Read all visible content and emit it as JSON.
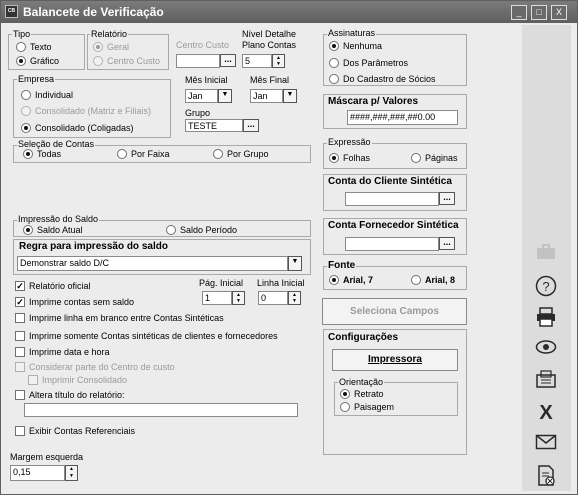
{
  "window": {
    "title": "Balancete de Verificação",
    "icon_text": "CB",
    "minimize": "_",
    "maximize": "□",
    "close": "X"
  },
  "tipo": {
    "label": "Tipo",
    "options": [
      "Texto",
      "Gráfico"
    ],
    "selected": "Gráfico"
  },
  "relatorio": {
    "label": "Relatório",
    "options": [
      "Geral",
      "Centro Custo"
    ],
    "selected": "Geral"
  },
  "centro_custo": {
    "label": "Centro Custo",
    "value": "",
    "button": "..."
  },
  "nivel_detalhe": {
    "label_1": "Nível Detalhe",
    "label_2": "Plano Contas",
    "value": "5"
  },
  "empresa": {
    "label": "Empresa",
    "options": [
      "Individual",
      "Consolidado (Matriz e Filiais)",
      "Consolidado (Coligadas)"
    ],
    "selected": "Consolidado (Coligadas)"
  },
  "mes_inicial": {
    "label": "Mês Inicial",
    "value": "Jan"
  },
  "mes_final": {
    "label": "Mês Final",
    "value": "Jan"
  },
  "grupo": {
    "label": "Grupo",
    "value": "TESTE",
    "button": "..."
  },
  "selecao_contas": {
    "label": "Seleção de Contas",
    "options": [
      "Todas",
      "Por Faixa",
      "Por Grupo"
    ],
    "selected": "Todas"
  },
  "impressao_saldo": {
    "label": "Impressão do Saldo",
    "options": [
      "Saldo Atual",
      "Saldo Período"
    ],
    "selected": "Saldo Atual"
  },
  "regra_impressao": {
    "label": "Regra para impressão do saldo",
    "value": "Demonstrar saldo D/C"
  },
  "relatorio_oficial": {
    "label": "Relatório oficial",
    "checked": true
  },
  "pag_inicial": {
    "label": "Pág. Inicial",
    "value": "1"
  },
  "linha_inicial": {
    "label": "Linha Inicial",
    "value": "0"
  },
  "checks": [
    {
      "label": "Imprime contas sem saldo",
      "checked": true
    },
    {
      "label": "Imprime linha em branco entre Contas Sintéticas",
      "checked": false
    },
    {
      "label": "Imprime somente Contas sintéticas  de clientes e fornecedores",
      "checked": false
    },
    {
      "label": "Imprime data e hora",
      "checked": false
    },
    {
      "label": "Considerar parte do Centro de custo",
      "checked": false
    },
    {
      "label": "Imprimir Consolidado",
      "checked": false
    },
    {
      "label": "Altera título do relatório:",
      "checked": false
    },
    {
      "label": "Exibir Contas Referenciais",
      "checked": false
    }
  ],
  "titulo_relatorio": {
    "value": ""
  },
  "margem_esquerda": {
    "label": "Margem esquerda",
    "value": "0,15"
  },
  "assinaturas": {
    "label": "Assinaturas",
    "options": [
      "Nenhuma",
      "Dos Parâmetros",
      "Do Cadastro de Sócios"
    ],
    "selected": "Nenhuma"
  },
  "mascara": {
    "label": "Máscara p/ Valores",
    "value": "####,###,###,##0.00"
  },
  "expressao": {
    "label": "Expressão",
    "options": [
      "Folhas",
      "Páginas"
    ],
    "selected": "Folhas"
  },
  "conta_cliente": {
    "label": "Conta do Cliente Sintética",
    "value": "",
    "button": "..."
  },
  "conta_fornecedor": {
    "label": "Conta Fornecedor Sintética",
    "value": "",
    "button": "..."
  },
  "fonte": {
    "label": "Fonte",
    "options": [
      "Arial, 7",
      "Arial, 8"
    ],
    "selected": "Arial, 7"
  },
  "seleciona_campos": {
    "label": "Seleciona Campos"
  },
  "configuracoes": {
    "label": "Configurações",
    "impressora": "Impressora"
  },
  "orientacao": {
    "label": "Orientação",
    "options": [
      "Retrato",
      "Paisagem"
    ],
    "selected": "Retrato"
  },
  "sidebar_icons": [
    "briefcase-icon",
    "help-icon",
    "print-icon",
    "preview-icon",
    "fax-icon",
    "close-icon",
    "email-icon",
    "export-icon"
  ],
  "colors": {
    "titlebar": "#6a6a6a",
    "window_bg": "#ececec",
    "sidebar_bg": "#dcdcdc"
  }
}
